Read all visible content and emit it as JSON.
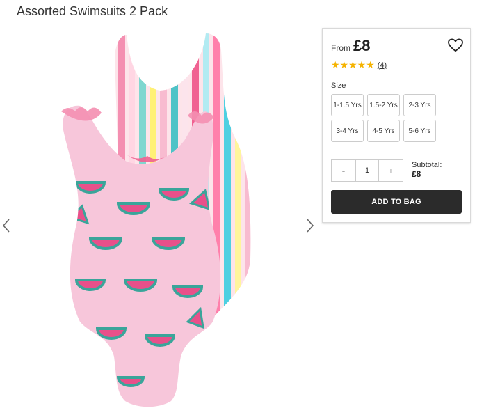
{
  "product": {
    "title": "Assorted Swimsuits 2 Pack",
    "image_description_icon": "swimsuit-image"
  },
  "gallery": {
    "prev_icon": "chevron-left-icon",
    "next_icon": "chevron-right-icon"
  },
  "purchase": {
    "from_label": "From",
    "price": "£8",
    "wishlist_icon": "heart-icon",
    "rating_stars": "★★★★★",
    "rating_value": 5,
    "review_count": "(4)",
    "size_label": "Size",
    "sizes": [
      "1-1.5 Yrs",
      "1.5-2 Yrs",
      "2-3 Yrs",
      "3-4 Yrs",
      "4-5 Yrs",
      "5-6 Yrs"
    ],
    "qty_minus": "-",
    "qty_value": "1",
    "qty_plus": "+",
    "subtotal_label": "Subtotal:",
    "subtotal_value": "£8",
    "add_to_bag": "ADD TO BAG"
  },
  "colors": {
    "star": "#f5b301",
    "button_bg": "#2b2b2b",
    "swimsuit_pink": "#f7b9d3",
    "watermelon": "#e8508a",
    "rind": "#3aa59a"
  }
}
